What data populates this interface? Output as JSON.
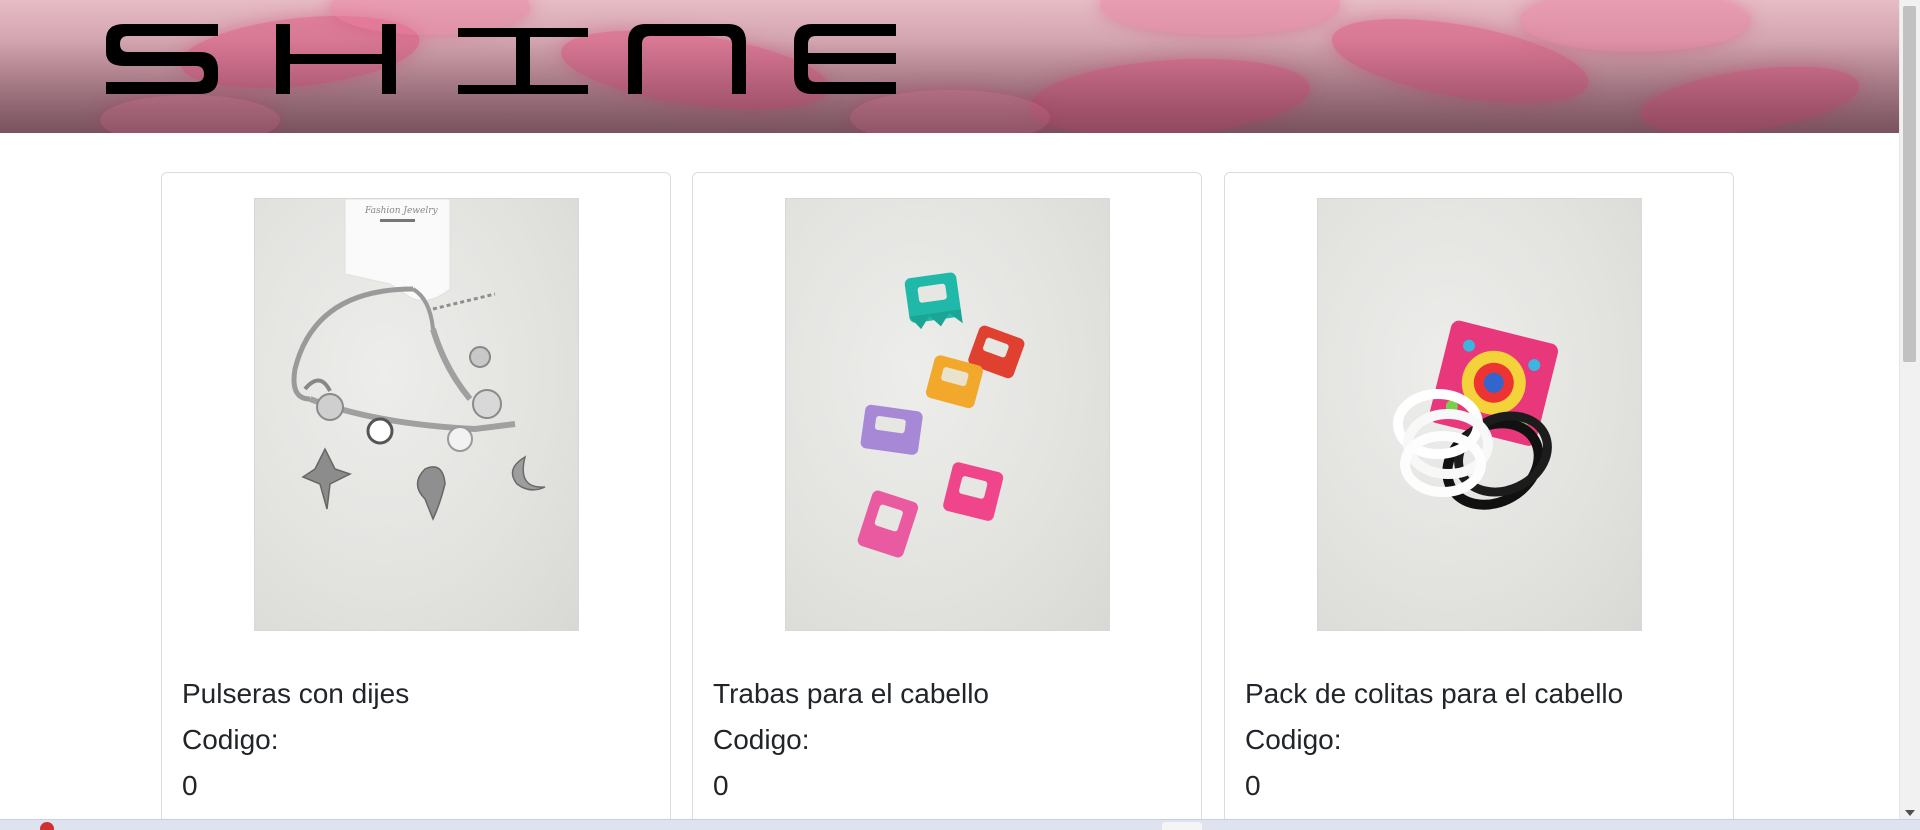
{
  "header": {
    "logo_text": "SHINE",
    "logo_icon": "shine-logo",
    "background": "pink-lips-banner"
  },
  "products": [
    {
      "name": "Pulseras con dijes",
      "code_label": "Codigo:",
      "code_value": "0",
      "image": "charm-bracelet-photo"
    },
    {
      "name": "Trabas para el cabello",
      "code_label": "Codigo:",
      "code_value": "0",
      "image": "hair-claw-clips-photo"
    },
    {
      "name": "Pack de colitas para el cabello",
      "code_label": "Codigo:",
      "code_value": "0",
      "image": "hair-ties-pack-photo"
    }
  ],
  "colors": {
    "text": "#212529",
    "card_border": "#dcdcdc",
    "banner_pink": "#dd5480"
  }
}
